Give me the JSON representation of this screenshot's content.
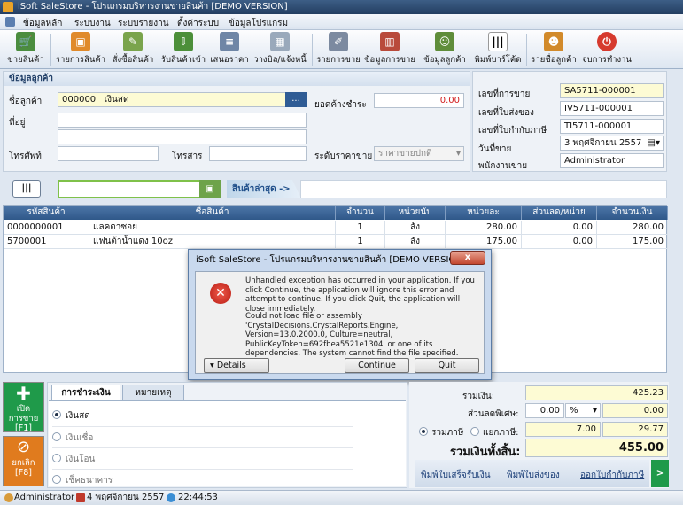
{
  "window": {
    "title": "iSoft SaleStore - โปรแกรมบริหารงานขายสินค้า [DEMO VERSION]"
  },
  "menu": [
    "ข้อมูลหลัก",
    "ระบบงาน",
    "ระบบรายงาน",
    "ตั้งค่าระบบ",
    "ข้อมูลโปรแกรม"
  ],
  "toolbar": {
    "sell": "ขายสินค้า",
    "product_list": "รายการสินค้า",
    "order": "สั่งซื้อสินค้า",
    "receive": "รับสินค้าเข้า",
    "quote": "เสนอราคา",
    "billing": "วางบิล/แจ้งหนี้",
    "sales_list": "รายการขาย",
    "sales_data": "ข้อมูลการขาย",
    "customer_data": "ข้อมูลลูกค้า",
    "barcode": "พิมพ์บาร์โค้ด",
    "customer_list": "รายชื่อลูกค้า",
    "exit": "จบการทำงาน"
  },
  "customer": {
    "header": "ข้อมูลลูกค้า",
    "name_label": "ชื่อลูกค้า",
    "code": "000000",
    "name": "เงินสด",
    "browse": "...",
    "address_label": "ที่อยู่",
    "phone_label": "โทรศัพท์",
    "fax_label": "โทรสาร",
    "balance_label": "ยอดค้างชำระ",
    "balance": "0.00",
    "price_level_label": "ระดับราคาขาย",
    "price_level": "ราคาขายปกติ"
  },
  "document": {
    "sale_no_label": "เลขที่การขาย",
    "sale_no": "SA5711-000001",
    "delivery_label": "เลขที่ใบส่งของ",
    "delivery_no": "IV5711-000001",
    "tax_label": "เลขที่ใบกำกับภาษี",
    "tax_no": "TI5711-000001",
    "date_label": "วันที่ขาย",
    "date": "3 พฤศจิกายน  2557",
    "staff_label": "พนักงานขาย",
    "staff": "Administrator"
  },
  "scan": {
    "latest_label": "สินค้าล่าสุด ->"
  },
  "table": {
    "columns": [
      "รหัสสินค้า",
      "ชื่อสินค้า",
      "จำนวน",
      "หน่วยนับ",
      "หน่วยละ",
      "ส่วนลด/หน่วย",
      "จำนวนเงิน"
    ],
    "rows": [
      {
        "code": "0000000001",
        "name": "แลคตาซอย",
        "qty": "1",
        "unit": "ลัง",
        "price": "280.00",
        "discount": "0.00",
        "amount": "280.00"
      },
      {
        "code": "5700001",
        "name": "แฟนต้าน้ำแดง 10oz",
        "qty": "1",
        "unit": "ลัง",
        "price": "175.00",
        "discount": "0.00",
        "amount": "175.00"
      }
    ]
  },
  "dialog": {
    "title": "iSoft SaleStore - โปรแกรมบริหารงานขายสินค้า [DEMO VERSION]",
    "close": "x",
    "message1": "Unhandled exception has occurred in your application. If you click Continue, the application will ignore this error and attempt to continue. If you click Quit, the application will close immediately.",
    "message2": "Could not load file or assembly 'CrystalDecisions.CrystalReports.Engine, Version=13.0.2000.0, Culture=neutral, PublicKeyToken=692fbea5521e1304' or one of its dependencies. The system cannot find the file specified.",
    "details": "Details",
    "continue": "Continue",
    "quit": "Quit"
  },
  "actions": {
    "open_sale": "เปิด\nการขาย\n[F1]",
    "cancel": "ยกเลิก\n[F8]"
  },
  "payment": {
    "tab_pay": "การชำระเงิน",
    "tab_note": "หมายเหตุ",
    "opt_cash": "เงินสด",
    "opt_credit": "เงินเชื่อ",
    "opt_transfer": "เงินโอน",
    "opt_cheque": "เช็คธนาคาร"
  },
  "summary": {
    "total_label": "รวมเงิน:",
    "total": "425.23",
    "discount_label": "ส่วนลดพิเศษ:",
    "discount_value": "0.00",
    "discount_unit": "%",
    "discount_amount": "0.00",
    "vat_incl": "รวมภาษี",
    "vat_excl": "แยกภาษี:",
    "vat_rate": "7.00",
    "vat_amount": "29.77",
    "grand_label": "รวมเงินทั้งสิ้น:",
    "grand_total": "455.00",
    "print_receipt": "พิมพ์ใบเสร็จรับเงิน",
    "print_delivery": "พิมพ์ใบส่งของ",
    "issue_tax": "ออกใบกำกับภาษี",
    "go": ">"
  },
  "status": {
    "user": "Administrator",
    "date": "4 พฤศจิกายน 2557",
    "time": "22:44:53"
  },
  "colors": {
    "title_bar": "#233e61",
    "grid_header": "#2f5889",
    "accent_green": "#1f9a4a",
    "accent_orange": "#e07b1e",
    "error_red": "#cc1f1f"
  }
}
